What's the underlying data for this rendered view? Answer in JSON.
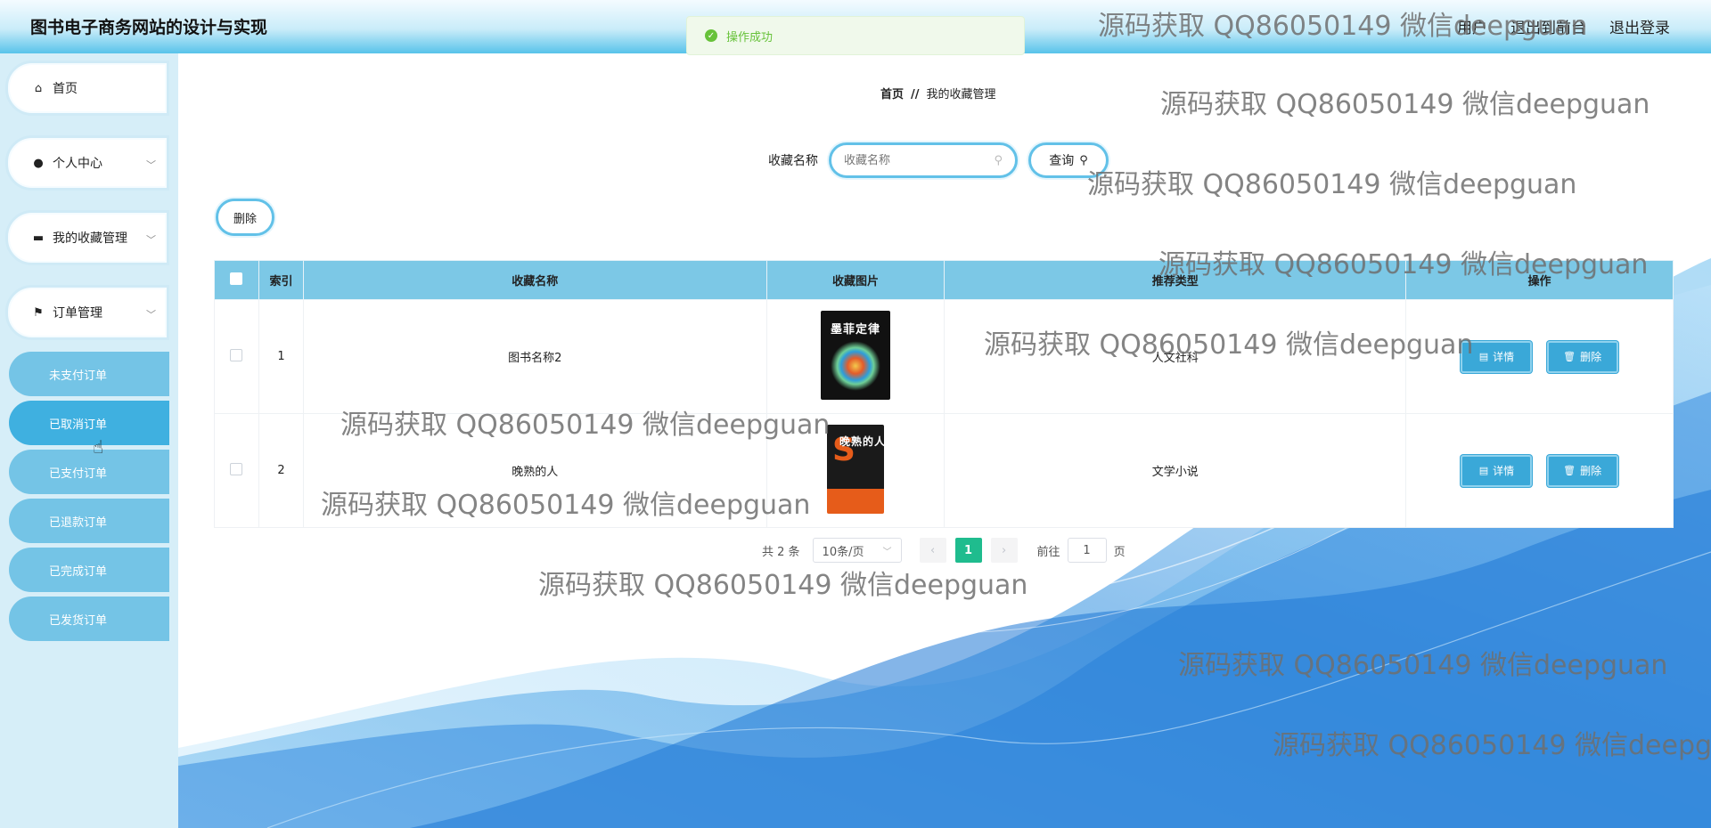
{
  "header": {
    "site_title": "图书电子商务网站的设计与实现",
    "links": [
      "用户",
      "退出到前台",
      "退出登录"
    ]
  },
  "toast": {
    "message": "操作成功"
  },
  "sidebar": {
    "items": [
      {
        "label": "首页",
        "icon": "home-icon"
      },
      {
        "label": "个人中心",
        "icon": "user-icon"
      },
      {
        "label": "我的收藏管理",
        "icon": "folder-icon"
      },
      {
        "label": "订单管理",
        "icon": "flag-icon"
      }
    ],
    "sub_items": [
      "未支付订单",
      "已取消订单",
      "已支付订单",
      "已退款订单",
      "已完成订单",
      "已发货订单"
    ],
    "active_sub": "已取消订单"
  },
  "breadcrumb": {
    "home": "首页",
    "separator": "//",
    "current": "我的收藏管理"
  },
  "search": {
    "label": "收藏名称",
    "placeholder": "收藏名称",
    "button": "查询"
  },
  "toolbar": {
    "delete_label": "删除"
  },
  "table": {
    "headers": [
      "索引",
      "收藏名称",
      "收藏图片",
      "推荐类型",
      "操作"
    ],
    "rows": [
      {
        "index": "1",
        "name": "图书名称2",
        "image_title": "墨菲定律",
        "type": "人文社科"
      },
      {
        "index": "2",
        "name": "晚熟的人",
        "image_title": "晚熟的人",
        "type": "文学小说"
      }
    ],
    "detail_label": "详情",
    "remove_label": "删除"
  },
  "pagination": {
    "total": "共 2 条",
    "page_size": "10条/页",
    "current_page": "1",
    "goto_label": "前往",
    "goto_value": "1",
    "page_suffix": "页"
  },
  "watermark": "源码获取 QQ86050149 微信deepguan",
  "colors": {
    "accent": "#3aa8d8",
    "sidebar_sub": "#74c4e6",
    "pager_active": "#1fbc8e",
    "toast_green": "#67c23a"
  }
}
